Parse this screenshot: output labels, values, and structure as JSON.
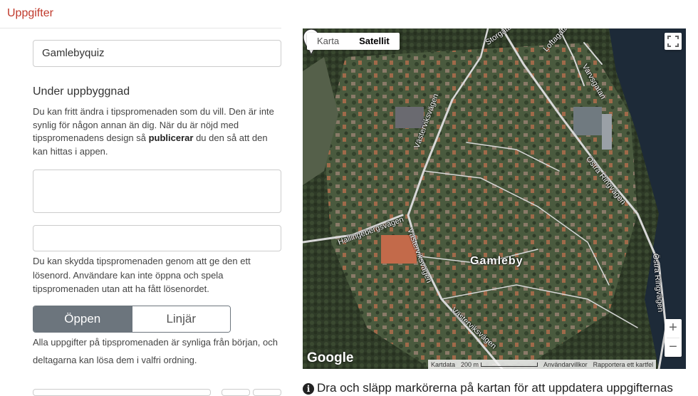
{
  "header": {
    "title": "Uppgifter"
  },
  "form": {
    "name_value": "Gamlebyquiz",
    "status_title": "Under uppbyggnad",
    "status_desc_1": "Du kan fritt ändra i tipspromenaden som du vill. Den är inte synlig för någon annan än dig. När du är nöjd med tipspromenadens design så ",
    "status_desc_bold": "publicerar",
    "status_desc_2": " du den så att den kan hittas i appen.",
    "description_value": "",
    "password_value": "",
    "password_help": "Du kan skydda tipspromenaden genom att ge den ett lösenord. Användare kan inte öppna och spela tipspromenaden utan att ha fått lösenordet.",
    "mode_options": [
      "Öppen",
      "Linjär"
    ],
    "mode_selected": "Öppen",
    "mode_help": "Alla uppgifter på tipspromenaden är synliga från början, och deltagarna kan lösa dem i valfri ordning."
  },
  "map": {
    "type_buttons": [
      "Karta",
      "Satellit"
    ],
    "active_type": "Satellit",
    "zoom_in": "+",
    "zoom_out": "−",
    "logo": "Google",
    "attribution": {
      "data": "Kartdata",
      "scale": "200 m",
      "terms": "Användarvillkor",
      "report": "Rapportera ett kartfel"
    },
    "labels": {
      "storgatan": "Storgatan",
      "loftagatan": "Loftagatan",
      "varvsgatan": "Varvsgatan",
      "vastervik1": "Västerviksvägen",
      "ostra1": "Östra Ringvägen",
      "hallinge": "Hallingebergsvägen",
      "vastervik2": "Västerviksvägen",
      "town": "Gamleby",
      "ostra2": "Östra Ringvägen",
      "vastervik3": "Västerviksvägen"
    },
    "colors": {
      "water": "#1d2a38",
      "vegetation": "#3d4a36",
      "road": "#d8d8d8"
    }
  },
  "map_info": "Dra och släpp markörerna på kartan för att uppdatera uppgifternas"
}
